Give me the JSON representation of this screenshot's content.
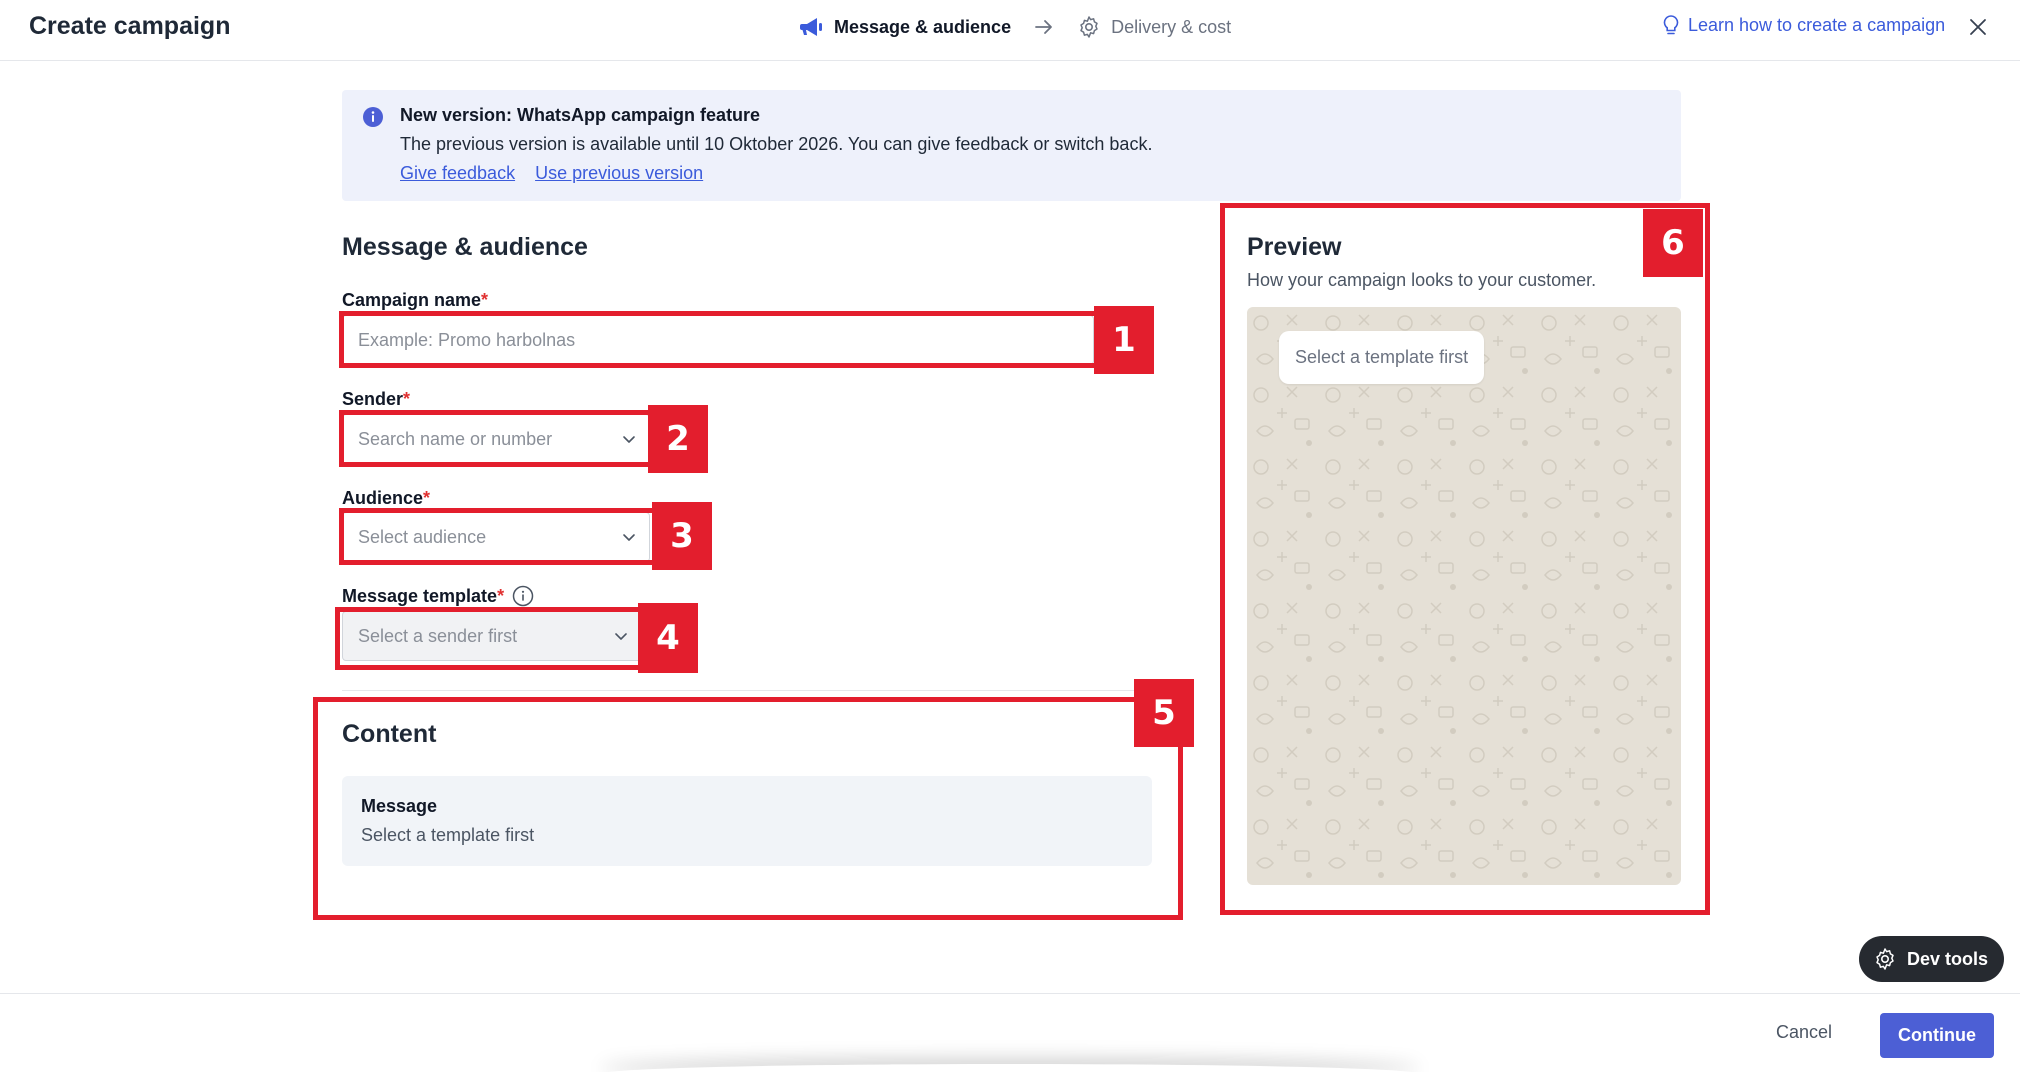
{
  "header": {
    "title": "Create campaign",
    "steps": [
      {
        "label": "Message & audience",
        "icon": "megaphone-icon",
        "active": true
      },
      {
        "label": "Delivery & cost",
        "icon": "gear-icon",
        "active": false
      }
    ],
    "learn_link": "Learn how to create a campaign"
  },
  "banner": {
    "title": "New version: WhatsApp campaign feature",
    "text": "The previous version is available until 10 Oktober 2026. You can give feedback or switch back.",
    "link_feedback": "Give feedback",
    "link_previous": "Use previous version"
  },
  "form": {
    "section_title": "Message & audience",
    "campaign_name": {
      "label": "Campaign name",
      "placeholder": "Example: Promo harbolnas",
      "value": ""
    },
    "sender": {
      "label": "Sender",
      "placeholder": "Search name or number"
    },
    "audience": {
      "label": "Audience",
      "placeholder": "Select audience"
    },
    "template": {
      "label": "Message template",
      "placeholder": "Select a sender first"
    },
    "required_mark": "*"
  },
  "content": {
    "title": "Content",
    "message_label": "Message",
    "message_value": "Select a template first"
  },
  "preview": {
    "title": "Preview",
    "subtitle": "How your campaign looks to your customer.",
    "bubble": "Select a template first"
  },
  "annotations": [
    "1",
    "2",
    "3",
    "4",
    "5",
    "6"
  ],
  "devtools": {
    "label": "Dev tools"
  },
  "footer": {
    "cancel": "Cancel",
    "continue": "Continue"
  },
  "colors": {
    "accent": "#4c5fd5",
    "link": "#3b5bdb",
    "annotation": "#e31e2d",
    "banner_bg": "#eef1fb",
    "wa_bg": "#e5e0d6"
  }
}
